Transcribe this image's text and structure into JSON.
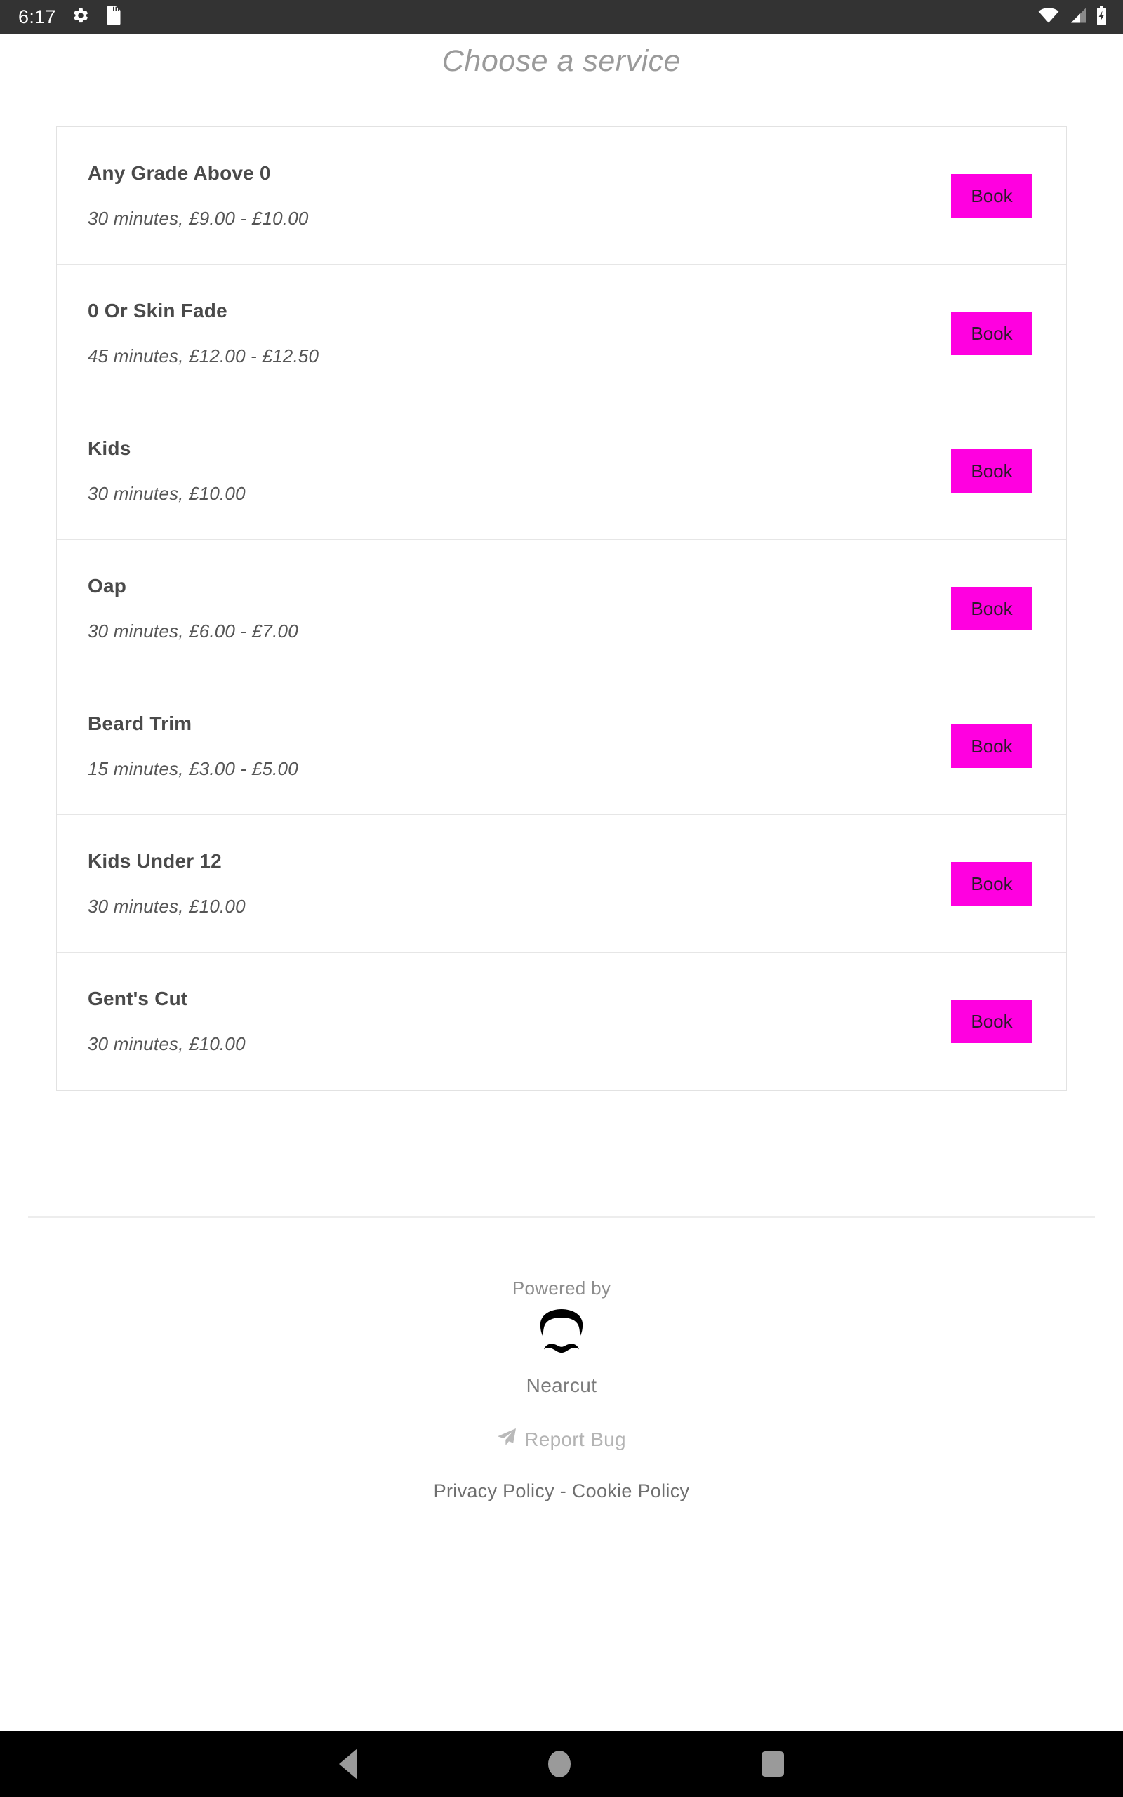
{
  "status_bar": {
    "time": "6:17",
    "left_icons": [
      "gear-icon",
      "sd-card-icon"
    ],
    "right_icons": [
      "wifi-icon",
      "cellular-signal-icon",
      "battery-charging-icon"
    ],
    "background_color": "#333333"
  },
  "page": {
    "title": "Choose a service",
    "accent_color": "#ff00e0"
  },
  "services": [
    {
      "name": "Any Grade Above 0",
      "meta": "30 minutes, £9.00 - £10.00",
      "book_label": "Book"
    },
    {
      "name": "0 Or Skin Fade",
      "meta": "45 minutes, £12.00 - £12.50",
      "book_label": "Book"
    },
    {
      "name": "Kids",
      "meta": "30 minutes, £10.00",
      "book_label": "Book"
    },
    {
      "name": "Oap",
      "meta": "30 minutes, £6.00 - £7.00",
      "book_label": "Book"
    },
    {
      "name": "Beard Trim",
      "meta": "15 minutes, £3.00 - £5.00",
      "book_label": "Book"
    },
    {
      "name": "Kids Under 12",
      "meta": "30 minutes, £10.00",
      "book_label": "Book"
    },
    {
      "name": "Gent's Cut",
      "meta": "30 minutes, £10.00",
      "book_label": "Book"
    }
  ],
  "footer": {
    "powered_by": "Powered by",
    "brand": "Nearcut",
    "brand_logo_icon": "mustache-hair-logo-icon",
    "report_bug": "Report Bug",
    "report_bug_icon": "paper-plane-icon",
    "privacy_policy": "Privacy Policy",
    "separator": "-",
    "cookie_policy": "Cookie Policy"
  },
  "nav_bar": {
    "back": "back-button",
    "home": "home-button",
    "recents": "recents-button"
  }
}
